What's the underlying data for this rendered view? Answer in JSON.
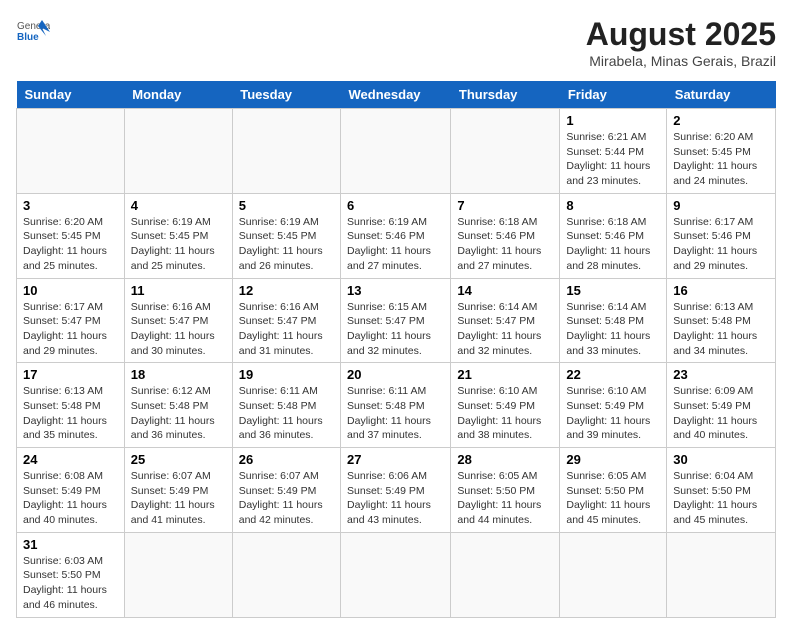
{
  "logo": {
    "text_general": "General",
    "text_blue": "Blue"
  },
  "title": "August 2025",
  "subtitle": "Mirabela, Minas Gerais, Brazil",
  "weekdays": [
    "Sunday",
    "Monday",
    "Tuesday",
    "Wednesday",
    "Thursday",
    "Friday",
    "Saturday"
  ],
  "weeks": [
    [
      {
        "day": "",
        "info": ""
      },
      {
        "day": "",
        "info": ""
      },
      {
        "day": "",
        "info": ""
      },
      {
        "day": "",
        "info": ""
      },
      {
        "day": "",
        "info": ""
      },
      {
        "day": "1",
        "info": "Sunrise: 6:21 AM\nSunset: 5:44 PM\nDaylight: 11 hours and 23 minutes."
      },
      {
        "day": "2",
        "info": "Sunrise: 6:20 AM\nSunset: 5:45 PM\nDaylight: 11 hours and 24 minutes."
      }
    ],
    [
      {
        "day": "3",
        "info": "Sunrise: 6:20 AM\nSunset: 5:45 PM\nDaylight: 11 hours and 25 minutes."
      },
      {
        "day": "4",
        "info": "Sunrise: 6:19 AM\nSunset: 5:45 PM\nDaylight: 11 hours and 25 minutes."
      },
      {
        "day": "5",
        "info": "Sunrise: 6:19 AM\nSunset: 5:45 PM\nDaylight: 11 hours and 26 minutes."
      },
      {
        "day": "6",
        "info": "Sunrise: 6:19 AM\nSunset: 5:46 PM\nDaylight: 11 hours and 27 minutes."
      },
      {
        "day": "7",
        "info": "Sunrise: 6:18 AM\nSunset: 5:46 PM\nDaylight: 11 hours and 27 minutes."
      },
      {
        "day": "8",
        "info": "Sunrise: 6:18 AM\nSunset: 5:46 PM\nDaylight: 11 hours and 28 minutes."
      },
      {
        "day": "9",
        "info": "Sunrise: 6:17 AM\nSunset: 5:46 PM\nDaylight: 11 hours and 29 minutes."
      }
    ],
    [
      {
        "day": "10",
        "info": "Sunrise: 6:17 AM\nSunset: 5:47 PM\nDaylight: 11 hours and 29 minutes."
      },
      {
        "day": "11",
        "info": "Sunrise: 6:16 AM\nSunset: 5:47 PM\nDaylight: 11 hours and 30 minutes."
      },
      {
        "day": "12",
        "info": "Sunrise: 6:16 AM\nSunset: 5:47 PM\nDaylight: 11 hours and 31 minutes."
      },
      {
        "day": "13",
        "info": "Sunrise: 6:15 AM\nSunset: 5:47 PM\nDaylight: 11 hours and 32 minutes."
      },
      {
        "day": "14",
        "info": "Sunrise: 6:14 AM\nSunset: 5:47 PM\nDaylight: 11 hours and 32 minutes."
      },
      {
        "day": "15",
        "info": "Sunrise: 6:14 AM\nSunset: 5:48 PM\nDaylight: 11 hours and 33 minutes."
      },
      {
        "day": "16",
        "info": "Sunrise: 6:13 AM\nSunset: 5:48 PM\nDaylight: 11 hours and 34 minutes."
      }
    ],
    [
      {
        "day": "17",
        "info": "Sunrise: 6:13 AM\nSunset: 5:48 PM\nDaylight: 11 hours and 35 minutes."
      },
      {
        "day": "18",
        "info": "Sunrise: 6:12 AM\nSunset: 5:48 PM\nDaylight: 11 hours and 36 minutes."
      },
      {
        "day": "19",
        "info": "Sunrise: 6:11 AM\nSunset: 5:48 PM\nDaylight: 11 hours and 36 minutes."
      },
      {
        "day": "20",
        "info": "Sunrise: 6:11 AM\nSunset: 5:48 PM\nDaylight: 11 hours and 37 minutes."
      },
      {
        "day": "21",
        "info": "Sunrise: 6:10 AM\nSunset: 5:49 PM\nDaylight: 11 hours and 38 minutes."
      },
      {
        "day": "22",
        "info": "Sunrise: 6:10 AM\nSunset: 5:49 PM\nDaylight: 11 hours and 39 minutes."
      },
      {
        "day": "23",
        "info": "Sunrise: 6:09 AM\nSunset: 5:49 PM\nDaylight: 11 hours and 40 minutes."
      }
    ],
    [
      {
        "day": "24",
        "info": "Sunrise: 6:08 AM\nSunset: 5:49 PM\nDaylight: 11 hours and 40 minutes."
      },
      {
        "day": "25",
        "info": "Sunrise: 6:07 AM\nSunset: 5:49 PM\nDaylight: 11 hours and 41 minutes."
      },
      {
        "day": "26",
        "info": "Sunrise: 6:07 AM\nSunset: 5:49 PM\nDaylight: 11 hours and 42 minutes."
      },
      {
        "day": "27",
        "info": "Sunrise: 6:06 AM\nSunset: 5:49 PM\nDaylight: 11 hours and 43 minutes."
      },
      {
        "day": "28",
        "info": "Sunrise: 6:05 AM\nSunset: 5:50 PM\nDaylight: 11 hours and 44 minutes."
      },
      {
        "day": "29",
        "info": "Sunrise: 6:05 AM\nSunset: 5:50 PM\nDaylight: 11 hours and 45 minutes."
      },
      {
        "day": "30",
        "info": "Sunrise: 6:04 AM\nSunset: 5:50 PM\nDaylight: 11 hours and 45 minutes."
      }
    ],
    [
      {
        "day": "31",
        "info": "Sunrise: 6:03 AM\nSunset: 5:50 PM\nDaylight: 11 hours and 46 minutes."
      },
      {
        "day": "",
        "info": ""
      },
      {
        "day": "",
        "info": ""
      },
      {
        "day": "",
        "info": ""
      },
      {
        "day": "",
        "info": ""
      },
      {
        "day": "",
        "info": ""
      },
      {
        "day": "",
        "info": ""
      }
    ]
  ]
}
